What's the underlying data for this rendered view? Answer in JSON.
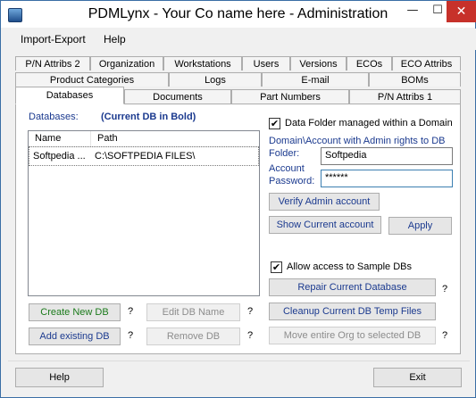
{
  "window": {
    "title": "PDMLynx - Your Co name here - Administration",
    "min": "—",
    "max": "☐",
    "close": "✕"
  },
  "menu": {
    "import_export": "Import-Export",
    "help": "Help"
  },
  "tabs": {
    "row1": [
      "P/N Attribs 2",
      "Organization",
      "Workstations",
      "Users",
      "Versions",
      "ECOs",
      "ECO Attribs"
    ],
    "row2": [
      "Product Categories",
      "Logs",
      "E-mail",
      "BOMs"
    ],
    "row3": [
      "Databases",
      "Documents",
      "Part Numbers",
      "P/N Attribs 1"
    ]
  },
  "databases": {
    "label": "Databases:",
    "current_note": "(Current DB in Bold)",
    "columns": [
      "Name",
      "Path"
    ],
    "rows": [
      {
        "name": "Softpedia ...",
        "path": "C:\\SOFTPEDIA FILES\\"
      }
    ]
  },
  "buttons": {
    "create_new_db": "Create New DB",
    "edit_db_name": "Edit DB Name",
    "add_existing_db": "Add existing DB",
    "remove_db": "Remove DB",
    "verify_admin": "Verify Admin account",
    "show_current": "Show Current account",
    "apply": "Apply",
    "repair_db": "Repair Current Database",
    "cleanup_temp": "Cleanup Current DB Temp Files",
    "move_org": "Move entire Org to selected DB",
    "help": "Help",
    "exit": "Exit",
    "question": "?"
  },
  "domain": {
    "checkbox_label": "Data Folder managed within a Domain",
    "checked": true,
    "account_label": "Domain\\Account with Admin rights to DB",
    "folder_label": "Folder:",
    "folder_value": "Softpedia",
    "password_label_1": "Account",
    "password_label_2": "Password:",
    "password_value": "******"
  },
  "sample_dbs": {
    "label": "Allow access to Sample DBs",
    "checked": true
  },
  "check_glyph": "✔"
}
